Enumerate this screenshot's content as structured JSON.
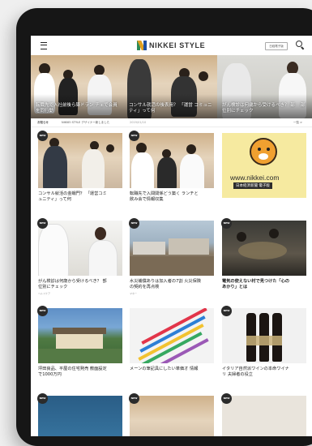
{
  "header": {
    "logo_text": "NIKKEI STYLE",
    "member_button": "日経電子版"
  },
  "hero": [
    {
      "caption": "転職先で入社前後ら築ドラン\nチェで会員を同行動"
    },
    {
      "caption": "コンサル就活の後表用？ 「運営\nコミュニティ」って何"
    },
    {
      "caption": "がん検診は何歳から受けるべき？\n部 　部位別にチェック"
    }
  ],
  "notice": {
    "label": "お知らせ",
    "text": "NIKKEI STYLE デザイナー新しました",
    "date": "2019/01/10",
    "more": "一覧 >"
  },
  "cards": [
    {
      "title": "コンサル就活の金戦門？ 「運営コミ\nュニティ」って何",
      "meta": "",
      "new": true
    },
    {
      "title": "転職先で入間関係どう築く ランチと\n飲み会で情報収集",
      "meta": "",
      "new": true
    },
    {
      "title": "",
      "meta": "",
      "new": false,
      "ad_url": "www.nikkei.com",
      "ad_label": "日本経済新聞 電子版"
    },
    {
      "title": "がん検診は何歳から受けるべき？ 部\n位別にチェック",
      "meta": "ヘルスケア",
      "new": true
    },
    {
      "title": "水災補償ありは加入者の7割 火災保険\nの契約を再点検",
      "meta": "マネー",
      "new": true
    },
    {
      "title": "電気の使えない村で見つけた「心の\nあかり」とは",
      "meta": "",
      "new": true
    },
    {
      "title": "坪田良品、平屋の住宅発売 敷面設定\nで1000万円",
      "meta": "",
      "new": true
    },
    {
      "title": "メーンの筆記具にしたい単価オ 情報",
      "meta": "",
      "new": true
    },
    {
      "title": "イタリア自然派ワインの本命ワイナ\nリ 夫婦者の役立",
      "meta": "",
      "new": true
    }
  ],
  "badge_label": "NEW"
}
